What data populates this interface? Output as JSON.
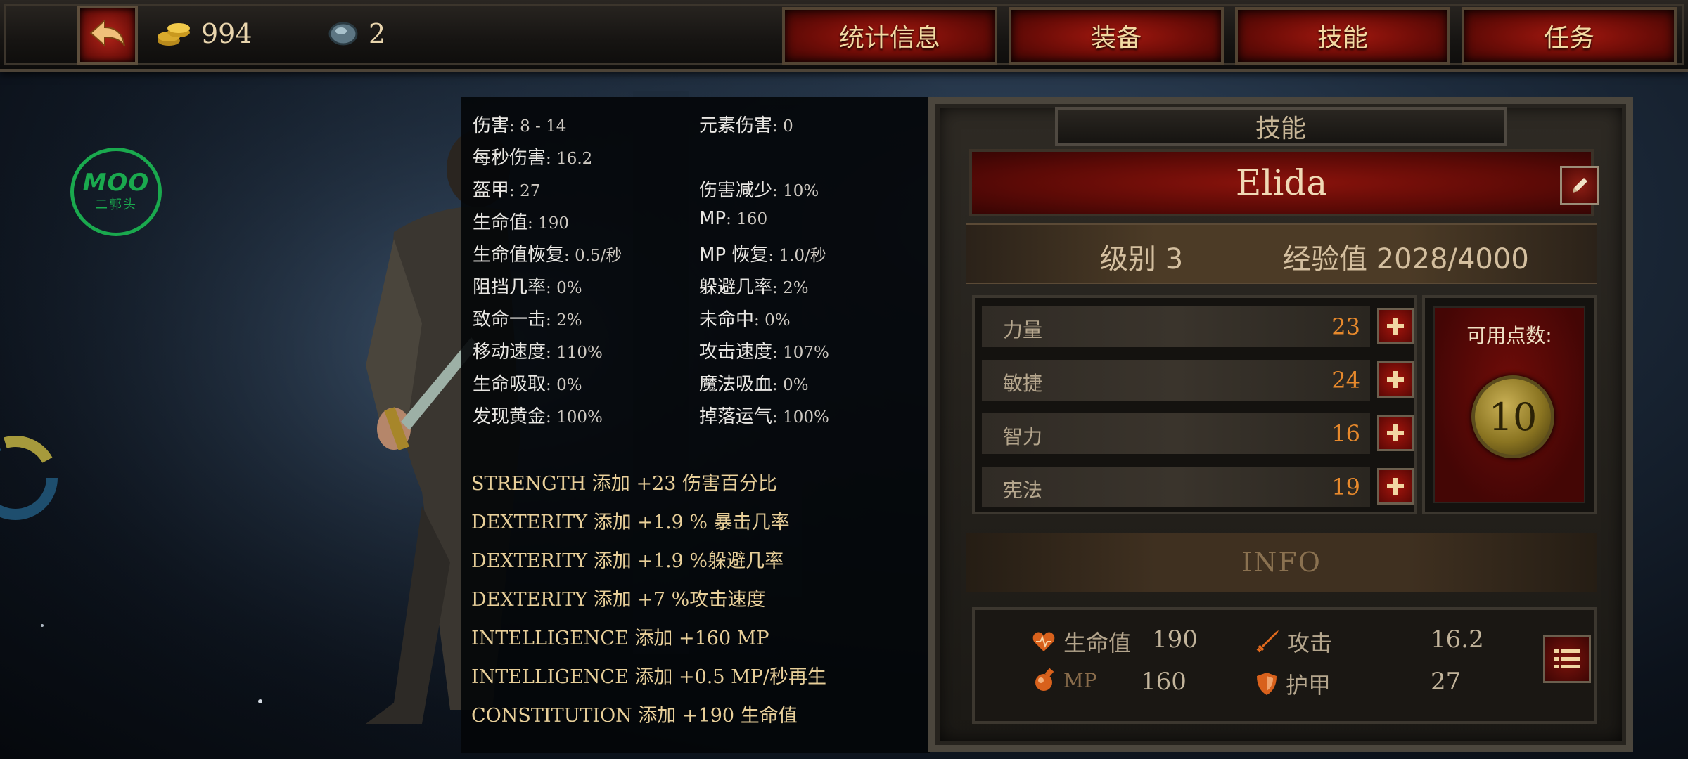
{
  "topbar": {
    "gold": "994",
    "gems": "2",
    "tabs": [
      "统计信息",
      "装备",
      "技能",
      "任务"
    ]
  },
  "logo": {
    "main": "MOO",
    "sub": "二郭头"
  },
  "stats": {
    "left": [
      {
        "label": "伤害",
        "value": ": 8 - 14"
      },
      {
        "label": "每秒伤害",
        "value": ": 16.2"
      },
      {
        "label": "盔甲",
        "value": ": 27"
      },
      {
        "label": "生命值",
        "value": ": 190"
      },
      {
        "label": "生命值恢复",
        "value": ": 0.5/秒"
      },
      {
        "label": "阻挡几率",
        "value": ": 0%"
      },
      {
        "label": "致命一击",
        "value": ": 2%"
      },
      {
        "label": "移动速度",
        "value": ": 110%"
      },
      {
        "label": "生命吸取",
        "value": ": 0%"
      },
      {
        "label": "发现黄金",
        "value": ": 100%"
      }
    ],
    "right": [
      {
        "label": "元素伤害",
        "value": ": 0"
      },
      {
        "label": "",
        "value": ""
      },
      {
        "label": "伤害减少",
        "value": ": 10%"
      },
      {
        "label": "MP",
        "value": ": 160"
      },
      {
        "label": "MP 恢复",
        "value": ": 1.0/秒"
      },
      {
        "label": "躲避几率",
        "value": ": 2%"
      },
      {
        "label": "未命中",
        "value": ": 0%"
      },
      {
        "label": "攻击速度",
        "value": ": 107%"
      },
      {
        "label": "魔法吸血",
        "value": ": 0%"
      },
      {
        "label": "掉落运气",
        "value": ": 100%"
      }
    ],
    "bonuses": [
      "STRENGTH 添加 +23 伤害百分比",
      "DEXTERITY 添加 +1.9 % 暴击几率",
      "DEXTERITY 添加 +1.9 %躲避几率",
      "DEXTERITY 添加 +7 %攻击速度",
      "INTELLIGENCE 添加 +160 MP",
      "INTELLIGENCE 添加 +0.5 MP/秒再生",
      "CONSTITUTION 添加 +190 生命值"
    ]
  },
  "panel": {
    "title": "技能",
    "name": "Elida",
    "level": "级别 3",
    "exp": "经验值 2028/4000",
    "attributes": [
      {
        "label": "力量",
        "value": "23"
      },
      {
        "label": "敏捷",
        "value": "24"
      },
      {
        "label": "智力",
        "value": "16"
      },
      {
        "label": "宪法",
        "value": "19"
      }
    ],
    "points_label": "可用点数:",
    "points": "10",
    "info_title": "INFO",
    "info": {
      "hp_label": "生命值",
      "hp": "190",
      "atk_label": "攻击",
      "atk": "16.2",
      "mp_label": "MP",
      "mp": "160",
      "armor_label": "护甲",
      "armor": "27"
    }
  },
  "colors": {
    "accent_red": "#8b130c",
    "gold_text": "#e8cf99",
    "orange_value": "#e7892c",
    "logo_green": "#1aa94e"
  },
  "icons": [
    "back-arrow-icon",
    "gold-coins-icon",
    "gem-icon",
    "pencil-icon",
    "plus-icon",
    "heart-icon",
    "sword-icon",
    "potion-icon",
    "shield-icon",
    "list-icon",
    "loading-ring-icon"
  ]
}
